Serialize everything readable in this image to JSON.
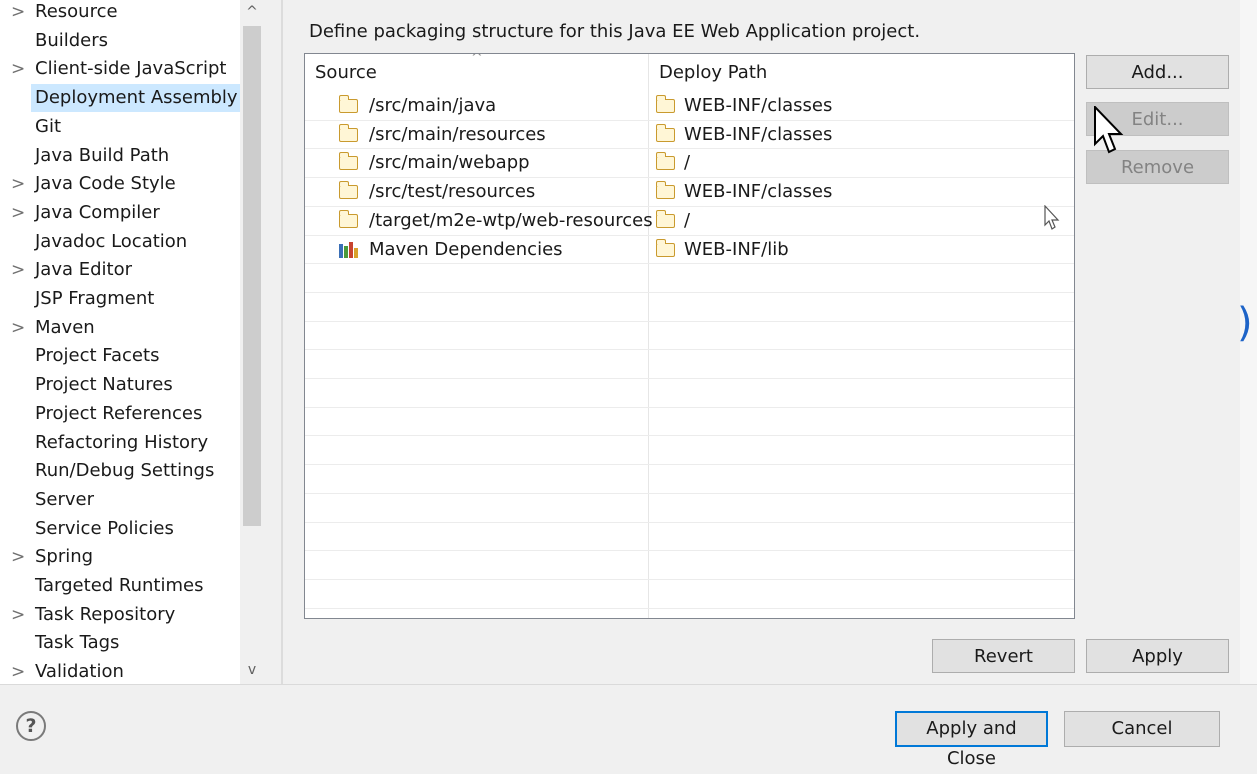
{
  "nav": {
    "items": [
      {
        "label": "Resource",
        "expandable": true
      },
      {
        "label": "Builders",
        "expandable": false
      },
      {
        "label": "Client-side JavaScript",
        "expandable": true
      },
      {
        "label": "Deployment Assembly",
        "expandable": false,
        "selected": true
      },
      {
        "label": "Git",
        "expandable": false
      },
      {
        "label": "Java Build Path",
        "expandable": false
      },
      {
        "label": "Java Code Style",
        "expandable": true
      },
      {
        "label": "Java Compiler",
        "expandable": true
      },
      {
        "label": "Javadoc Location",
        "expandable": false
      },
      {
        "label": "Java Editor",
        "expandable": true
      },
      {
        "label": "JSP Fragment",
        "expandable": false
      },
      {
        "label": "Maven",
        "expandable": true
      },
      {
        "label": "Project Facets",
        "expandable": false
      },
      {
        "label": "Project Natures",
        "expandable": false
      },
      {
        "label": "Project References",
        "expandable": false
      },
      {
        "label": "Refactoring History",
        "expandable": false
      },
      {
        "label": "Run/Debug Settings",
        "expandable": false
      },
      {
        "label": "Server",
        "expandable": false
      },
      {
        "label": "Service Policies",
        "expandable": false
      },
      {
        "label": "Spring",
        "expandable": true
      },
      {
        "label": "Targeted Runtimes",
        "expandable": false
      },
      {
        "label": "Task Repository",
        "expandable": true
      },
      {
        "label": "Task Tags",
        "expandable": false
      },
      {
        "label": "Validation",
        "expandable": true
      }
    ],
    "chevron": ">",
    "scroll_up": "^",
    "scroll_down": "v"
  },
  "content": {
    "description": "Define packaging structure for this Java EE Web Application project.",
    "table": {
      "headers": {
        "source": "Source",
        "deploy_path": "Deploy Path"
      },
      "rows": [
        {
          "source": "/src/main/java",
          "source_icon": "folder-icon",
          "deploy": "WEB-INF/classes"
        },
        {
          "source": "/src/main/resources",
          "source_icon": "folder-icon",
          "deploy": "WEB-INF/classes"
        },
        {
          "source": "/src/main/webapp",
          "source_icon": "folder-icon",
          "deploy": "/"
        },
        {
          "source": "/src/test/resources",
          "source_icon": "folder-icon",
          "deploy": "WEB-INF/classes"
        },
        {
          "source": "/target/m2e-wtp/web-resources",
          "source_icon": "folder-icon",
          "deploy": "/"
        },
        {
          "source": "Maven Dependencies",
          "source_icon": "library-icon",
          "deploy": "WEB-INF/lib"
        }
      ]
    },
    "buttons": {
      "add": "Add...",
      "edit": "Edit...",
      "remove": "Remove",
      "revert": "Revert",
      "apply": "Apply"
    }
  },
  "footer": {
    "help": "?",
    "apply_and_close": "Apply and Close",
    "cancel": "Cancel"
  },
  "colors": {
    "selection": "#cce8ff",
    "focus_border": "#0078d7",
    "folder": "#c99a2e"
  }
}
